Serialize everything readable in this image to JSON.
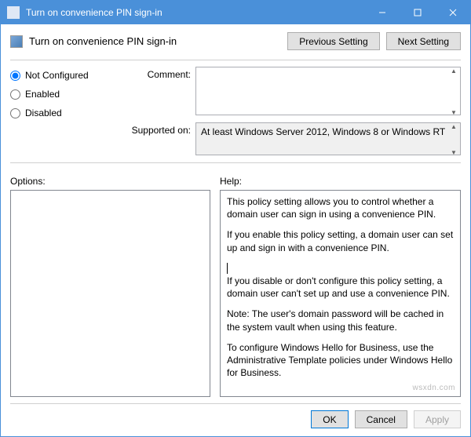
{
  "window": {
    "title": "Turn on convenience PIN sign-in"
  },
  "header": {
    "title": "Turn on convenience PIN sign-in"
  },
  "nav": {
    "prev": "Previous Setting",
    "next": "Next Setting"
  },
  "state": {
    "options": {
      "not_configured": "Not Configured",
      "enabled": "Enabled",
      "disabled": "Disabled"
    },
    "selected": "not_configured"
  },
  "labels": {
    "comment": "Comment:",
    "supported": "Supported on:",
    "options": "Options:",
    "help": "Help:"
  },
  "comment": {
    "value": ""
  },
  "supported": {
    "value": "At least Windows Server 2012, Windows 8 or Windows RT"
  },
  "help": {
    "p1": "This policy setting allows you to control whether a domain user can sign in using a convenience PIN.",
    "p2": "If you enable this policy setting, a domain user can set up and sign in with a convenience PIN.",
    "p3": "If you disable or don't configure this policy setting, a domain user can't set up and use a convenience PIN.",
    "p4": "Note: The user's domain password will be cached in the system vault when using this feature.",
    "p5": "To configure Windows Hello for Business, use the Administrative Template policies under Windows Hello for Business."
  },
  "footer": {
    "ok": "OK",
    "cancel": "Cancel",
    "apply": "Apply"
  },
  "watermark": "wsxdn.com"
}
